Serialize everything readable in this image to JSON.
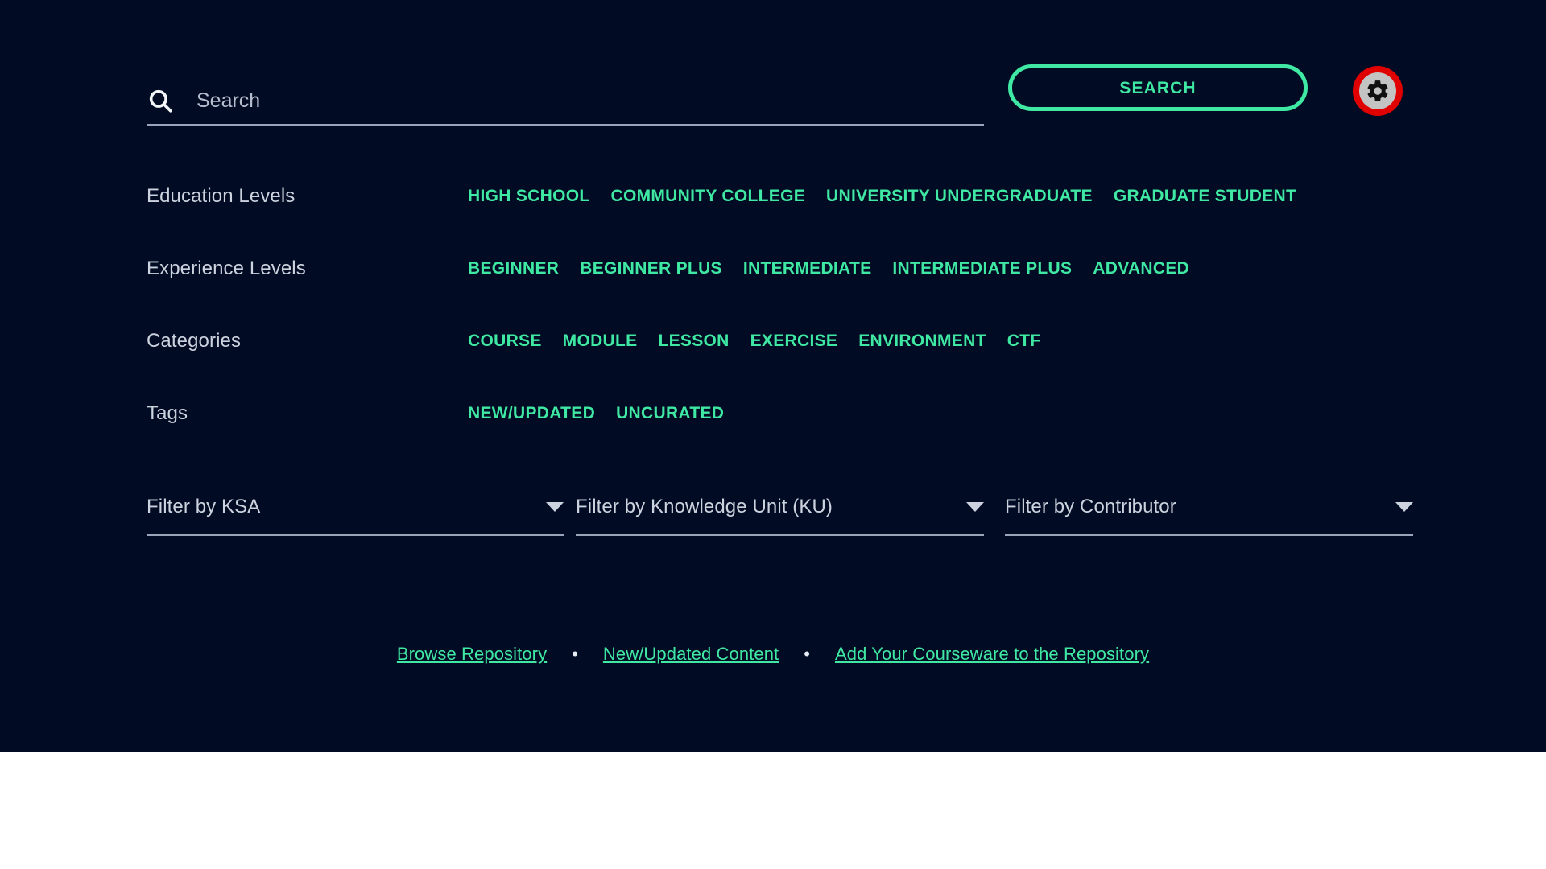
{
  "theme": {
    "background": "#020b24",
    "accent_green": "#3fe8a3",
    "label_gray": "#ccd2de",
    "settings_red": "#e00000",
    "page_background": "#ffffff"
  },
  "search": {
    "icon": "search-icon",
    "placeholder": "Search",
    "value": "",
    "button_label": "SEARCH",
    "settings_icon": "gear-icon"
  },
  "facets": [
    {
      "label": "Education Levels",
      "chips": [
        "HIGH SCHOOL",
        "COMMUNITY COLLEGE",
        "UNIVERSITY UNDERGRADUATE",
        "GRADUATE STUDENT"
      ]
    },
    {
      "label": "Experience Levels",
      "chips": [
        "BEGINNER",
        "BEGINNER PLUS",
        "INTERMEDIATE",
        "INTERMEDIATE PLUS",
        "ADVANCED"
      ]
    },
    {
      "label": "Categories",
      "chips": [
        "COURSE",
        "MODULE",
        "LESSON",
        "EXERCISE",
        "ENVIRONMENT",
        "CTF"
      ]
    },
    {
      "label": "Tags",
      "chips": [
        "NEW/UPDATED",
        "UNCURATED"
      ]
    }
  ],
  "dropdowns": [
    {
      "value": "Filter by KSA",
      "caret": "chevron-down-icon"
    },
    {
      "value": "Filter by Knowledge Unit (KU)",
      "caret": "chevron-down-icon"
    },
    {
      "value": "Filter by Contributor",
      "caret": "chevron-down-icon"
    }
  ],
  "footer": {
    "separator": "•",
    "links": [
      "Browse Repository",
      "New/Updated Content",
      "Add Your Courseware to the Repository"
    ]
  }
}
